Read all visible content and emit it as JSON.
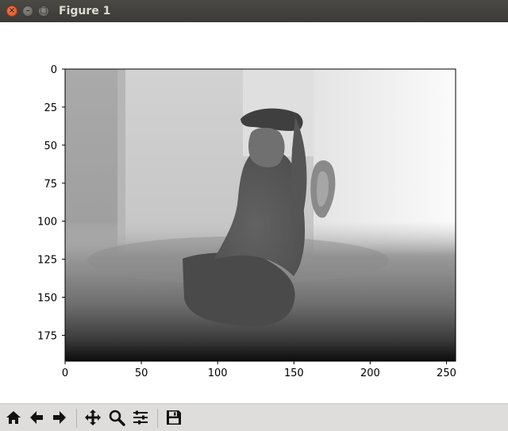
{
  "window": {
    "title": "Figure 1"
  },
  "titlebar_buttons": [
    {
      "name": "close-window-button",
      "glyph": "×"
    },
    {
      "name": "minimize-window-button",
      "glyph": "–"
    },
    {
      "name": "maximize-window-button",
      "glyph": "□"
    }
  ],
  "chart_data": {
    "type": "heatmap",
    "colormap": "gray",
    "image_size": [
      256,
      192
    ],
    "xlim": [
      0,
      256
    ],
    "ylim": [
      192,
      0
    ],
    "y_inverted": true,
    "xticks": [
      0,
      50,
      100,
      150,
      200,
      250
    ],
    "yticks": [
      0,
      25,
      50,
      75,
      100,
      125,
      150,
      175
    ],
    "xtick_labels": [
      "0",
      "50",
      "100",
      "150",
      "200",
      "250"
    ],
    "ytick_labels": [
      "0",
      "25",
      "50",
      "75",
      "100",
      "125",
      "150",
      "175"
    ],
    "title": "",
    "xlabel": "",
    "ylabel": ""
  },
  "toolbar": [
    {
      "name": "home-button",
      "icon": "home-icon"
    },
    {
      "name": "back-button",
      "icon": "arrow-left-icon"
    },
    {
      "name": "forward-button",
      "icon": "arrow-right-icon"
    },
    {
      "name": "pan-button",
      "icon": "move-icon"
    },
    {
      "name": "zoom-button",
      "icon": "magnifier-icon"
    },
    {
      "name": "configure-subplots-button",
      "icon": "sliders-icon"
    },
    {
      "name": "save-button",
      "icon": "floppy-disk-icon"
    }
  ],
  "colors": {
    "titlebar": "#3d3c38",
    "toolbar": "#dedddb",
    "close_button": "#e8602c"
  }
}
